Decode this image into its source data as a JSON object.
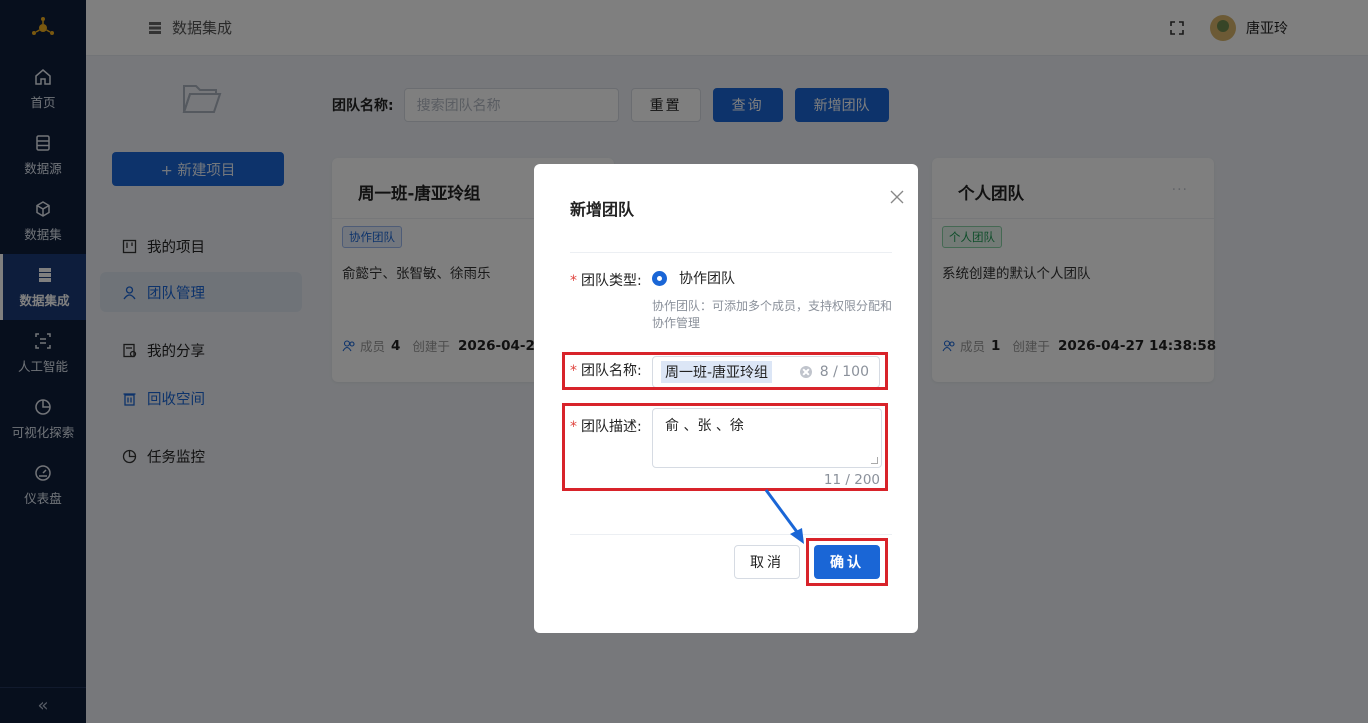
{
  "nav": {
    "items": [
      {
        "label": "首页",
        "icon": "home-icon"
      },
      {
        "label": "数据源",
        "icon": "data-source-icon"
      },
      {
        "label": "数据集",
        "icon": "dataset-icon"
      },
      {
        "label": "数据集成",
        "icon": "data-integration-icon"
      },
      {
        "label": "人工智能",
        "icon": "ai-icon"
      },
      {
        "label": "可视化探索",
        "icon": "chart-icon"
      },
      {
        "label": "仪表盘",
        "icon": "dashboard-icon"
      }
    ],
    "collapse": "«"
  },
  "header": {
    "title": "数据集成",
    "user_name": "唐亚玲"
  },
  "sidebar": {
    "new_project": "+ 新建项目",
    "items": [
      {
        "label": "我的项目",
        "icon": "project-icon"
      },
      {
        "label": "团队管理",
        "icon": "team-icon"
      },
      {
        "label": "我的分享",
        "icon": "share-icon"
      },
      {
        "label": "回收空间",
        "icon": "trash-icon"
      },
      {
        "label": "任务监控",
        "icon": "monitor-icon"
      }
    ]
  },
  "filter": {
    "label": "团队名称:",
    "placeholder": "搜索团队名称",
    "reset": "重置",
    "query": "查询",
    "add": "新增团队"
  },
  "cards": [
    {
      "title": "周一班-唐亚玲组",
      "tag": "协作团队",
      "desc": "俞懿宁、张智敏、徐雨乐",
      "members_label": "成员",
      "members": "4",
      "created_label": "创建于",
      "created": "2026-04-2"
    },
    {
      "title": "个人团队",
      "more": "···",
      "tag": "个人团队",
      "desc": "系统创建的默认个人团队",
      "members_label": "成员",
      "members": "1",
      "created_label": "创建于",
      "created": "2026-04-27 14:38:58"
    }
  ],
  "modal": {
    "title": "新增团队",
    "type_label": "团队类型:",
    "type_value": "协作团队",
    "type_hint": "协作团队：可添加多个成员，支持权限分配和协作管理",
    "name_label": "团队名称:",
    "name_value": "周一班-唐亚玲组",
    "name_count": "8 / 100",
    "desc_label": "团队描述:",
    "desc_value": "俞   、张   、徐",
    "desc_count": "11 / 200",
    "cancel": "取消",
    "ok": "确认"
  },
  "colors": {
    "nav_bg": "#0f1e3a",
    "primary": "#1a66d6",
    "highlight": "#d8232a",
    "required": "#e0443e"
  }
}
